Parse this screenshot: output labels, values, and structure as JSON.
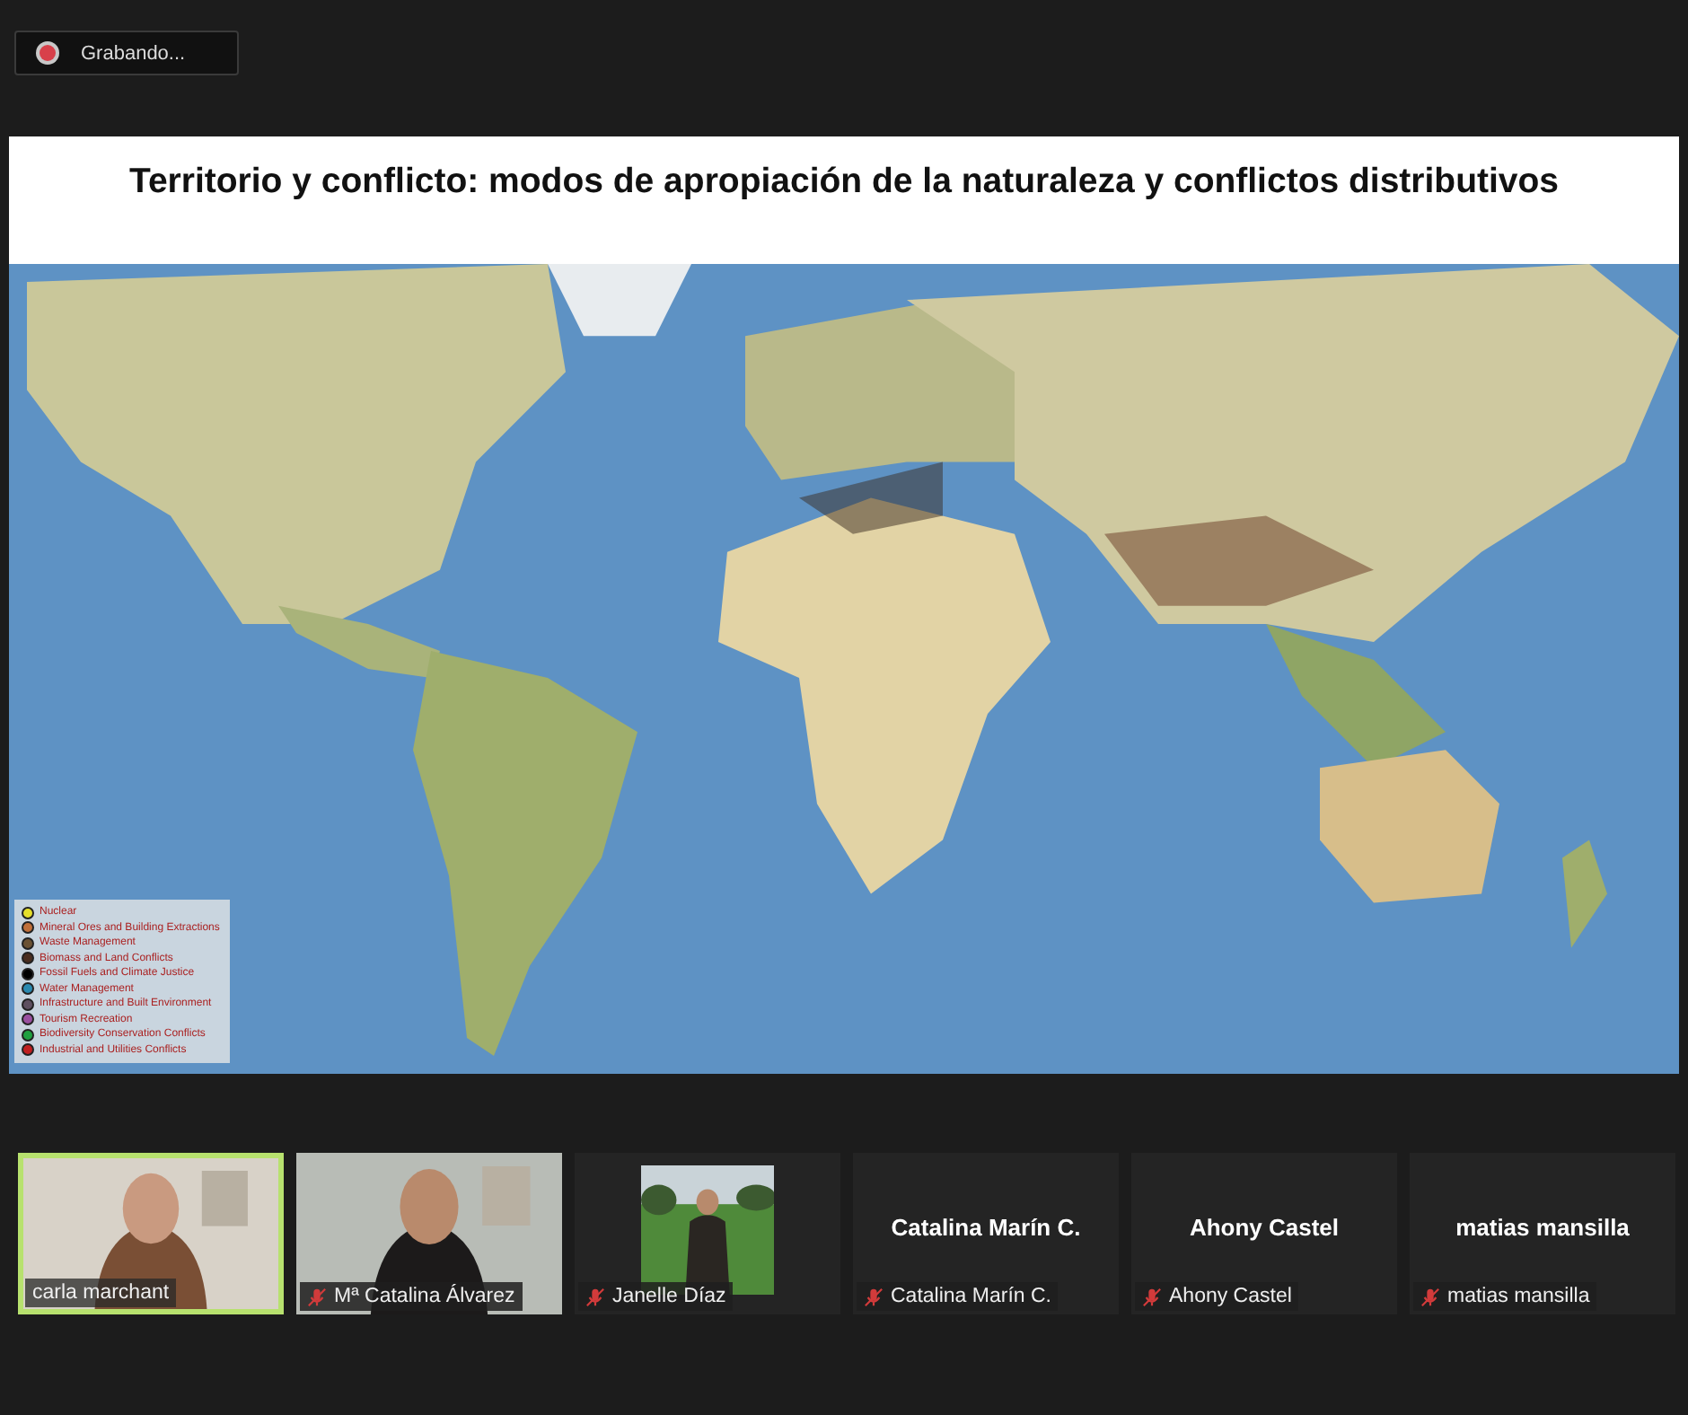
{
  "recording": {
    "label": "Grabando..."
  },
  "slide": {
    "title": "Territorio y conflicto: modos de apropiación de la naturaleza y conflictos distributivos",
    "legend": [
      {
        "label": "Nuclear",
        "color": "#e6df2a"
      },
      {
        "label": "Mineral Ores and Building Extractions",
        "color": "#c0703a"
      },
      {
        "label": "Waste Management",
        "color": "#6b5233"
      },
      {
        "label": "Biomass and Land Conflicts",
        "color": "#4a2e20"
      },
      {
        "label": "Fossil Fuels and Climate Justice",
        "color": "#000000"
      },
      {
        "label": "Water Management",
        "color": "#2a8ab0"
      },
      {
        "label": "Infrastructure and Built Environment",
        "color": "#5e5060"
      },
      {
        "label": "Tourism Recreation",
        "color": "#9a50a0"
      },
      {
        "label": "Biodiversity Conservation Conflicts",
        "color": "#20a040"
      },
      {
        "label": "Industrial and Utilities Conflicts",
        "color": "#c02020"
      }
    ]
  },
  "participants": [
    {
      "name": "carla marchant",
      "kind": "video",
      "speaking": true,
      "muted": false
    },
    {
      "name": "Mª Catalina Álvarez",
      "kind": "video",
      "speaking": false,
      "muted": true
    },
    {
      "name": "Janelle Díaz",
      "speaking": false,
      "muted": true
    },
    {
      "name": "Catalina Marín C.",
      "display": "Catalina Marín C.",
      "kind": "name",
      "speaking": false,
      "muted": true
    },
    {
      "name": "Ahony Castel",
      "display": "Ahony Castel",
      "kind": "name",
      "speaking": false,
      "muted": true
    },
    {
      "name": "matias mansilla",
      "display": "matias mansilla",
      "kind": "name",
      "speaking": false,
      "muted": true
    }
  ]
}
